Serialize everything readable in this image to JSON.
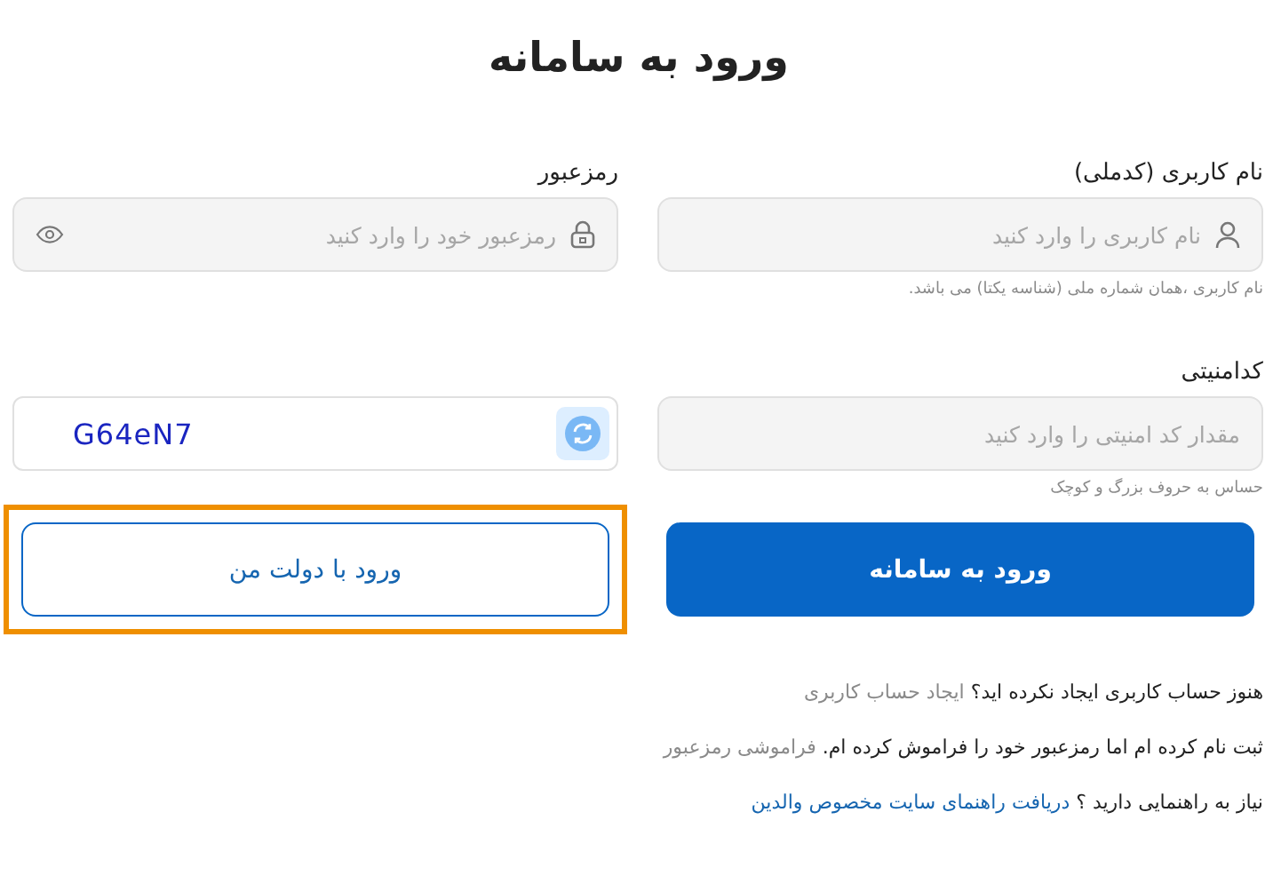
{
  "title": "ورود به سامانه",
  "fields": [
    {
      "kind": "username",
      "label": "نام کاربری (کدملی)",
      "placeholder": "نام کاربری را وارد کنید",
      "hint": "نام کاربری ،همان شماره ملی (شناسه یکتا) می باشد."
    },
    {
      "kind": "password",
      "label": "رمزعبور",
      "placeholder": "رمزعبور خود را وارد کنید"
    },
    {
      "kind": "captcha_input",
      "label": "کدامنیتی",
      "placeholder": "مقدار کد امنیتی را وارد کنید",
      "hint": "حساس به حروف بزرگ و کوچک"
    },
    {
      "kind": "captcha",
      "code": "G64eN7"
    }
  ],
  "buttons": [
    {
      "label": "ورود به سامانه",
      "kind": "primary",
      "highlighted": false
    },
    {
      "label": "ورود با دولت من",
      "kind": "outline",
      "highlighted": true
    }
  ],
  "links": [
    {
      "text": "هنوز حساب کاربری ایجاد نکرده اید؟",
      "link": "ایجاد حساب کاربری",
      "color": "#8a8a8a"
    },
    {
      "text": "ثبت نام کرده ام اما رمزعبور خود را فراموش کرده ام.",
      "link": "فراموشی رمزعبور",
      "color": "#8a8a8a"
    },
    {
      "text": "نیاز به راهنمایی دارید ؟",
      "link": "دریافت راهنمای سایت مخصوص والدین",
      "color": "#1565b0"
    }
  ]
}
